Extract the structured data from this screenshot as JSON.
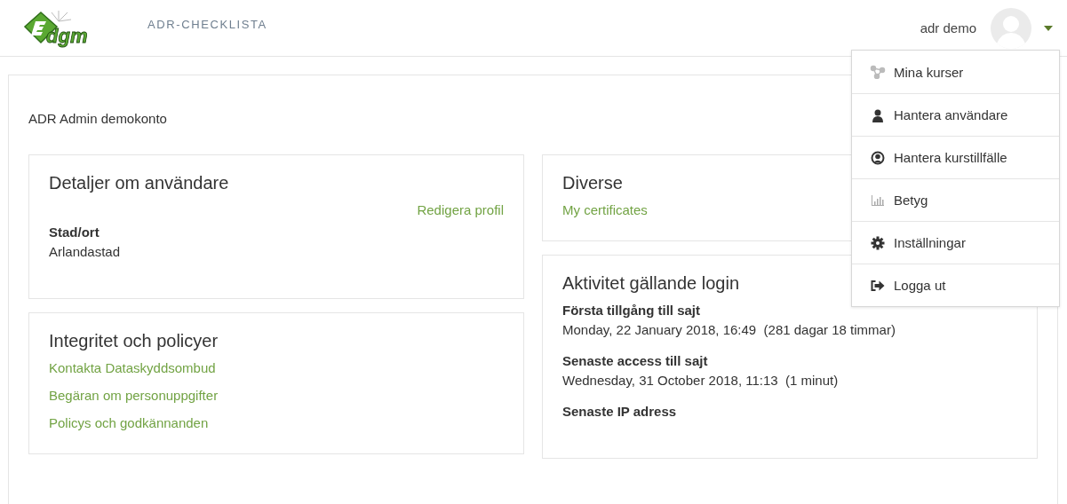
{
  "header": {
    "logo_text": "dgm",
    "site_name": "ADR-CHECKLISTA",
    "user_name": "adr demo"
  },
  "user_menu": {
    "expanded": true,
    "items": [
      {
        "label": "Mina kurser"
      },
      {
        "label": "Hantera användare"
      },
      {
        "label": "Hantera kurstillfälle"
      },
      {
        "label": "Betyg"
      },
      {
        "label": "Inställningar"
      },
      {
        "label": "Logga ut"
      }
    ]
  },
  "page_heading": "ADR Admin demokonto",
  "left_cards": [
    {
      "title": "Detaljer om användare",
      "action_link": "Redigera profil",
      "fields": [
        {
          "label": "Stad/ort",
          "value": "Arlandastad"
        }
      ]
    },
    {
      "title": "Integritet och policyer",
      "links": [
        "Kontakta Dataskyddsombud",
        "Begäran om personuppgifter",
        "Policys och godkännanden"
      ]
    }
  ],
  "right_cards": [
    {
      "title": "Diverse",
      "links": [
        "My certificates"
      ]
    },
    {
      "title": "Aktivitet gällande login",
      "fields": [
        {
          "label": "Första tillgång till sajt",
          "value": "Monday, 22 January 2018, 16:49  (281 dagar 18 timmar)"
        },
        {
          "label": "Senaste access till sajt",
          "value": "Wednesday, 31 October 2018, 11:13  (1 minut)"
        },
        {
          "label": "Senaste IP adress"
        }
      ]
    }
  ]
}
